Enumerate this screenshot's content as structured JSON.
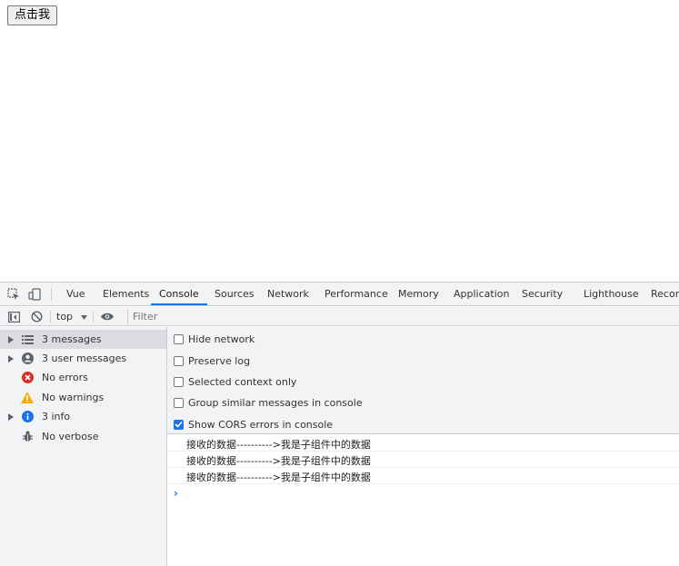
{
  "page": {
    "button_label": "点击我"
  },
  "devtools": {
    "tabs": [
      {
        "label": "Vue"
      },
      {
        "label": "Elements"
      },
      {
        "label": "Console"
      },
      {
        "label": "Sources"
      },
      {
        "label": "Network"
      },
      {
        "label": "Performance"
      },
      {
        "label": "Memory"
      },
      {
        "label": "Application"
      },
      {
        "label": "Security"
      },
      {
        "label": "Lighthouse"
      },
      {
        "label": "Record"
      }
    ],
    "active_tab": "Console",
    "toolbar": {
      "context": "top",
      "filter_placeholder": "Filter"
    },
    "sidebar": {
      "items": [
        {
          "label": "3 messages",
          "icon": "list-icon",
          "expandable": true,
          "selected": true
        },
        {
          "label": "3 user messages",
          "icon": "user-icon",
          "expandable": true,
          "selected": false
        },
        {
          "label": "No errors",
          "icon": "error-icon",
          "expandable": false,
          "selected": false
        },
        {
          "label": "No warnings",
          "icon": "warning-icon",
          "expandable": false,
          "selected": false
        },
        {
          "label": "3 info",
          "icon": "info-icon",
          "expandable": true,
          "selected": false
        },
        {
          "label": "No verbose",
          "icon": "bug-icon",
          "expandable": false,
          "selected": false
        }
      ]
    },
    "settings": [
      {
        "label": "Hide network",
        "checked": false
      },
      {
        "label": "Preserve log",
        "checked": false
      },
      {
        "label": "Selected context only",
        "checked": false
      },
      {
        "label": "Group similar messages in console",
        "checked": false
      },
      {
        "label": "Show CORS errors in console",
        "checked": true
      }
    ],
    "messages": [
      {
        "text": "接收的数据---------->我是子组件中的数据"
      },
      {
        "text": "接收的数据---------->我是子组件中的数据"
      },
      {
        "text": "接收的数据---------->我是子组件中的数据"
      }
    ],
    "prompt": "›"
  },
  "colors": {
    "accent": "#1a73e8",
    "error": "#d93025",
    "warning": "#f9ab00",
    "panel_bg": "#f1f3f4"
  }
}
